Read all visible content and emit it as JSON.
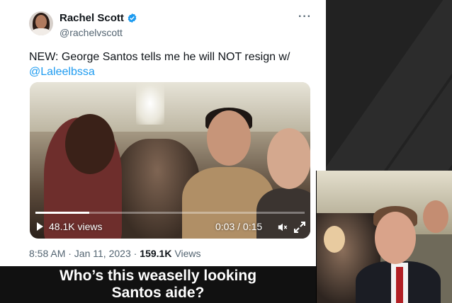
{
  "tweet": {
    "display_name": "Rachel Scott",
    "handle": "@rachelvscott",
    "more_label": "···",
    "text": "NEW: George Santos tells me he will NOT resign w/",
    "mention": "@Laleelbssa",
    "video": {
      "views": "48.1K views",
      "time": "0:03 / 0:15",
      "progress_fraction": 0.2
    },
    "timestamp": "8:58 AM · Jan 11, 2023 ·",
    "view_count": "159.1K",
    "views_label": "Views"
  },
  "caption": {
    "line1": "Who’s this weaselly looking",
    "line2": "Santos aide?"
  },
  "colors": {
    "verified_blue": "#1d9bf0",
    "link_blue": "#1d9bf0",
    "tie_red": "#b21f24"
  },
  "icons": [
    "verified-icon",
    "more-icon",
    "play-icon",
    "volume-icon",
    "fullscreen-icon"
  ]
}
